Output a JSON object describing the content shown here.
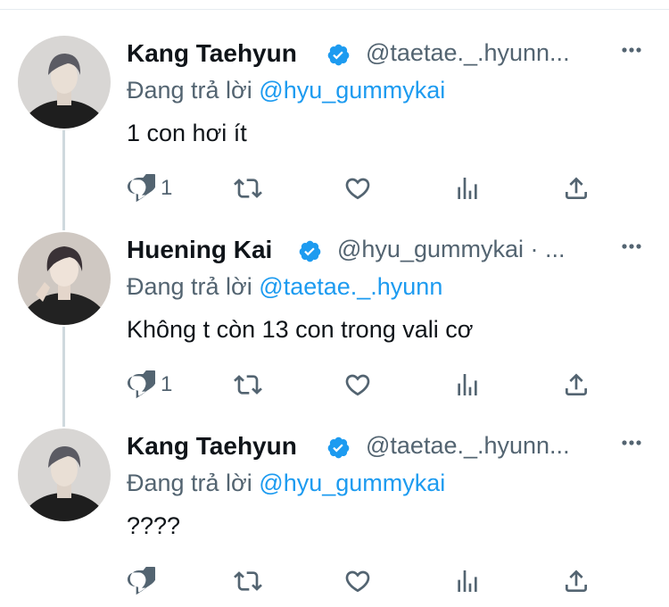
{
  "tweets": [
    {
      "name": "Kang Taehyun",
      "handle": "@taetae._.hyunn...",
      "reply_prefix": "Đang trả lời",
      "reply_to": "@hyu_gummykai",
      "text": "1 con hơi ít",
      "reply_count": "1"
    },
    {
      "name": "Huening Kai",
      "handle": "@hyu_gummykai · ...",
      "reply_prefix": "Đang trả lời",
      "reply_to": "@taetae._.hyunn",
      "text": "Không t còn 13 con trong vali cơ",
      "reply_count": "1"
    },
    {
      "name": "Kang Taehyun",
      "handle": "@taetae._.hyunn...",
      "reply_prefix": "Đang trả lời",
      "reply_to": "@hyu_gummykai",
      "text": "????",
      "reply_count": ""
    }
  ],
  "colors": {
    "accent": "#1d9bf0",
    "muted": "#536471",
    "verified": "#1d9bf0"
  },
  "icons": [
    "reply-icon",
    "retweet-icon",
    "like-icon",
    "analytics-icon",
    "share-icon",
    "more-icon",
    "verified-icon"
  ]
}
